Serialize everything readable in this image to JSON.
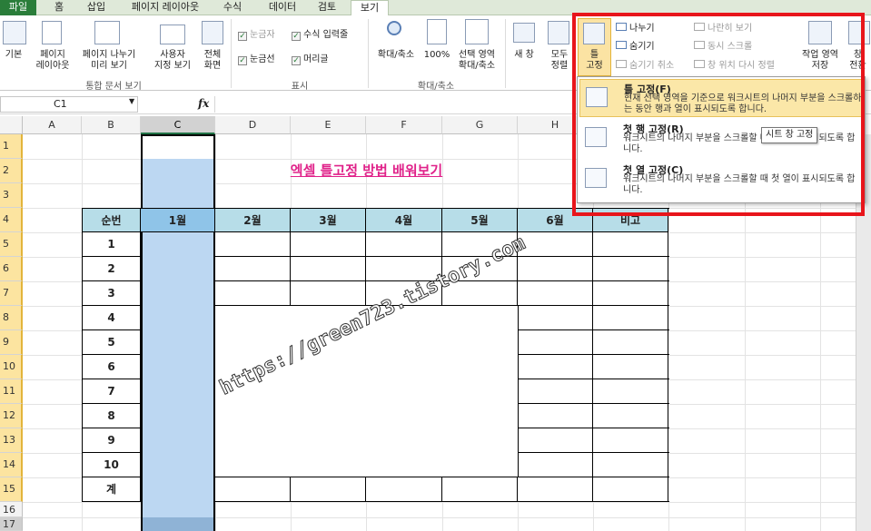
{
  "tabs": [
    "파일",
    "홈",
    "삽입",
    "페이지 레이아웃",
    "수식",
    "데이터",
    "검토",
    "보기"
  ],
  "ribbon": {
    "basic_view_label": "기본",
    "page_layout_label": "페이지\n레이아웃",
    "page_break_label": "페이지 나누기\n미리 보기",
    "custom_view_label": "사용자\n지정 보기",
    "full_screen_label": "전체\n화면",
    "group_workbook_views": "통합 문서 보기",
    "ruler_label": "눈금자",
    "formula_bar_label": "수식 입력줄",
    "gridlines_label": "눈금선",
    "headings_label": "머리글",
    "group_show": "표시",
    "zoom_label": "확대/축소",
    "zoom_100_label": "100%",
    "zoom_selection_label": "선택 영역\n확대/축소",
    "group_zoom": "확대/축소",
    "new_window_label": "새 창",
    "arrange_all_label": "모두\n정렬",
    "freeze_panes_label": "틀\n고정",
    "split_label": "나누기",
    "hide_label": "숨기기",
    "unhide_label": "숨기기 취소",
    "side_by_side_label": "나란히 보기",
    "sync_scroll_label": "동시 스크롤",
    "reset_position_label": "창 위치 다시 정렬",
    "save_workspace_label": "작업 영역\n저장",
    "switch_windows_label": "창\n전환"
  },
  "name_box": "C1",
  "fx_label": "fx",
  "columns": [
    "A",
    "B",
    "C",
    "D",
    "E",
    "F",
    "G",
    "H"
  ],
  "rows": [
    "1",
    "2",
    "3",
    "4",
    "5",
    "6",
    "7",
    "8",
    "9",
    "10",
    "11",
    "12",
    "13",
    "14",
    "15",
    "16",
    "17"
  ],
  "sheet": {
    "title": "엑셀 틀고정 방법 배워보기",
    "headers": [
      "순번",
      "1월",
      "2월",
      "3월",
      "4월",
      "5월",
      "6월",
      "비고"
    ],
    "row_numbers": [
      "1",
      "2",
      "3",
      "4",
      "5",
      "6",
      "7",
      "8",
      "9",
      "10",
      "계"
    ],
    "watermark": "https://green723.tistory.com"
  },
  "freeze_menu": {
    "items": [
      {
        "title": "틀 고정(F)",
        "desc": "현재 선택 영역을 기준으로 워크시트의 나머지 부분을 스크롤하는 동안 행과 열이 표시되도록 합니다."
      },
      {
        "title": "첫 행 고정(R)",
        "desc": "워크시트의 나머지 부분을 스크롤할 때 첫 행이 표시되도록 합니다."
      },
      {
        "title": "첫 열 고정(C)",
        "desc": "워크시트의 나머지 부분을 스크롤할 때 첫 열이 표시되도록 합니다."
      }
    ]
  },
  "tooltip": "시트 창 고정",
  "colors": {
    "accent_green": "#217346",
    "header_blue": "#b7dde8",
    "selected_col": "#bcd7f2",
    "title_magenta": "#e0228a",
    "highlight_red": "#e8151b"
  }
}
